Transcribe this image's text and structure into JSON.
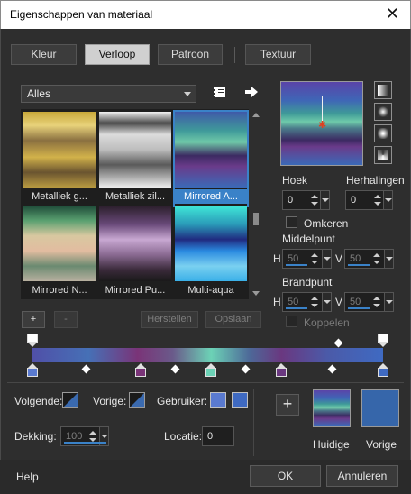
{
  "window": {
    "title": "Eigenschappen van materiaal",
    "close_glyph": "✕"
  },
  "tabs": [
    "Kleur",
    "Verloop",
    "Patroon",
    "Textuur"
  ],
  "active_tab": "Verloop",
  "category_select": {
    "value": "Alles"
  },
  "gallery": {
    "items": [
      {
        "label": "Metalliek g...",
        "colors": [
          "#c8a83a",
          "#e8d27a",
          "#8a7040",
          "#d2b24a",
          "#6a5430",
          "#b89a40"
        ]
      },
      {
        "label": "Metalliek zil...",
        "colors": [
          "#f2f2f2",
          "#4a4a4a",
          "#dcdcdc",
          "#bdbdbd",
          "#5a5a5a",
          "#eeeeee"
        ]
      },
      {
        "label": "Mirrored A...",
        "colors": [
          "#3f5aa8",
          "#3f9a9a",
          "#6fc8a8",
          "#3c2a62",
          "#6a3b8a",
          "#3b6ab8"
        ],
        "selected": true
      },
      {
        "label": "Mirrored N...",
        "colors": [
          "#1e4a38",
          "#5aa070",
          "#d8c8a0",
          "#e2bca0",
          "#6a8a70",
          "#b8b0a0"
        ]
      },
      {
        "label": "Mirrored Pu...",
        "colors": [
          "#2a1e2a",
          "#6a4a7a",
          "#c8a8d2",
          "#8a6a92",
          "#3a2a3a",
          "#1a1a1a"
        ]
      },
      {
        "label": "Multi-aqua",
        "colors": [
          "#40e8d8",
          "#2a9ab8",
          "#202a80",
          "#2a8ae0",
          "#7ad0f0",
          "#3ab0e8"
        ]
      }
    ]
  },
  "gallery_buttons": {
    "add": "+",
    "remove": "-",
    "restore": "Herstellen",
    "save": "Opslaan"
  },
  "angle": {
    "label": "Hoek",
    "value": "0"
  },
  "repeats": {
    "label": "Herhalingen",
    "value": "0"
  },
  "invert": {
    "label": "Omkeren",
    "checked": false
  },
  "center": {
    "label": "Middelpunt",
    "h_label": "H",
    "h_value": "50",
    "v_label": "V",
    "v_value": "50"
  },
  "focal": {
    "label": "Brandpunt",
    "h_label": "H",
    "h_value": "50",
    "v_label": "V",
    "v_value": "50"
  },
  "link": {
    "label": "Koppelen",
    "checked": false,
    "enabled": false
  },
  "style_icons": [
    "linear-gradient-icon",
    "rectangular-gradient-icon",
    "radial-gradient-icon",
    "sunburst-gradient-icon"
  ],
  "stops_row": {
    "next_label": "Volgende:",
    "prev_label": "Vorige:",
    "user_label": "Gebruiker:",
    "user_color_1": "#5a7ad0",
    "user_color_2": "#3f6ac2",
    "opacity_label": "Dekking:",
    "opacity_value": "100",
    "location_label": "Locatie:",
    "location_value": "0"
  },
  "current": {
    "label": "Huidige"
  },
  "previous": {
    "label": "Vorige",
    "color": "#3666aa"
  },
  "footer": {
    "help": "Help",
    "ok": "OK",
    "cancel": "Annuleren"
  },
  "add_glyph": "+"
}
